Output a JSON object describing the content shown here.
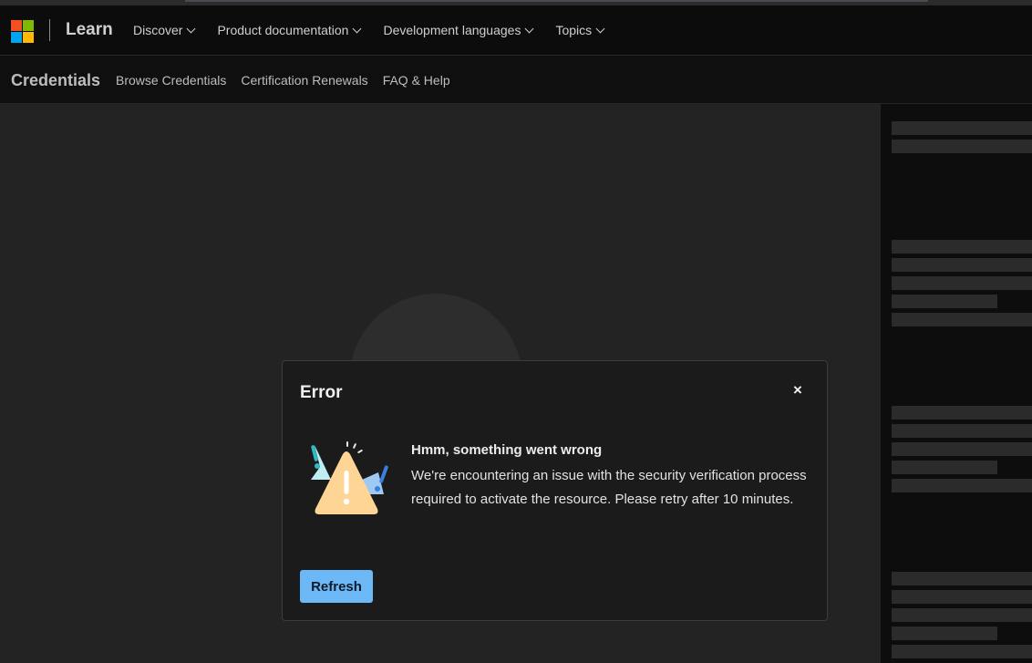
{
  "header": {
    "brand": "Learn",
    "nav": [
      {
        "label": "Discover"
      },
      {
        "label": "Product documentation"
      },
      {
        "label": "Development languages"
      },
      {
        "label": "Topics"
      }
    ],
    "logo_colors": [
      "#f25022",
      "#7fba00",
      "#00a4ef",
      "#ffb900"
    ]
  },
  "subheader": {
    "title": "Credentials",
    "links": [
      "Browse Credentials",
      "Certification Renewals",
      "FAQ & Help"
    ]
  },
  "dialog": {
    "title": "Error",
    "close_label": "×",
    "heading": "Hmm, something went wrong",
    "body": "We're encountering an issue with the security verification process required to activate the resource. Please retry after 10 minutes.",
    "button_label": "Refresh",
    "accent": "#6cb8f6"
  }
}
